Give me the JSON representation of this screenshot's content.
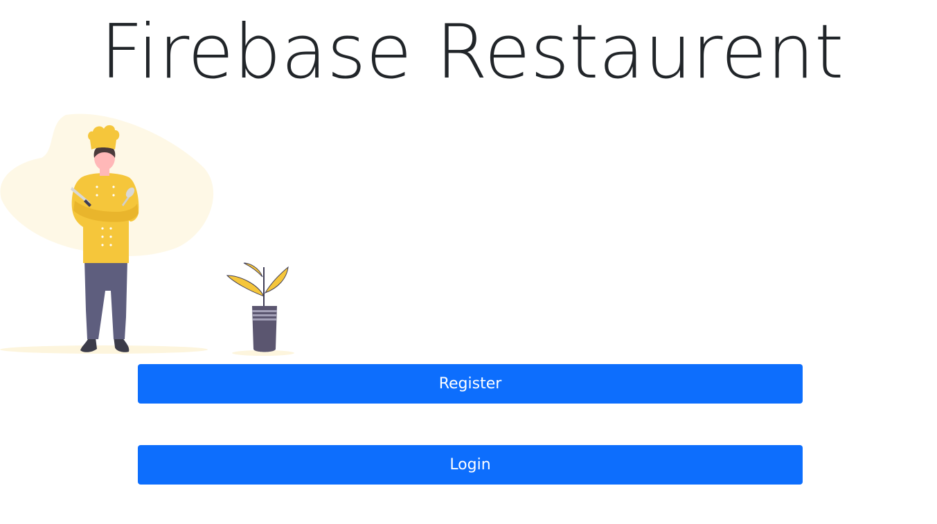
{
  "header": {
    "title": "Firebase Restaurent"
  },
  "illustration": {
    "icon": "chef-illustration",
    "colors": {
      "blob": "#fef8e6",
      "uniform": "#f5c63b",
      "skin": "#ffb8b8",
      "pants": "#5e5e7e",
      "pot": "#5b5670",
      "leaf": "#f5c63b"
    }
  },
  "actions": {
    "register_label": "Register",
    "login_label": "Login"
  },
  "theme": {
    "primary": "#0d6efd",
    "text": "#212529"
  }
}
